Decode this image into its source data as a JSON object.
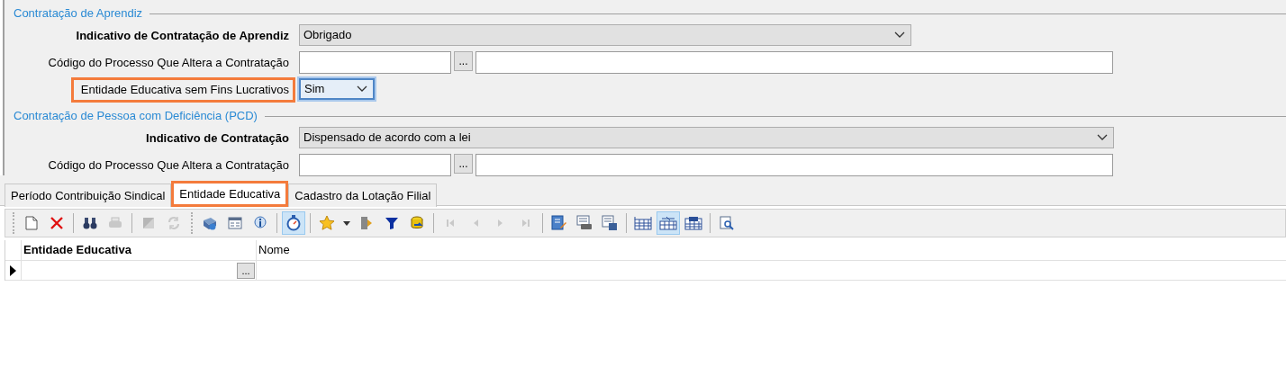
{
  "sections": [
    {
      "legend": "Contratação de Aprendiz",
      "rows": [
        {
          "kind": "select",
          "label": "Indicativo de Contratação de Aprendiz",
          "required": true,
          "highlighted": false,
          "focused": false,
          "value": "Obrigado"
        },
        {
          "kind": "lookup",
          "label": "Código do Processo Que Altera a Contratação",
          "required": false,
          "highlighted": false,
          "button_label": "..."
        },
        {
          "kind": "small_select",
          "label": "Entidade Educativa sem Fins Lucrativos",
          "required": false,
          "highlighted": true,
          "focused": true,
          "value": "Sim"
        }
      ]
    },
    {
      "legend": "Contratação de Pessoa com Deficiência (PCD)",
      "rows": [
        {
          "kind": "long_select",
          "label": "Indicativo de Contratação",
          "required": true,
          "highlighted": false,
          "focused": false,
          "value": "Dispensado de acordo com a lei"
        },
        {
          "kind": "lookup",
          "label": "Código do Processo Que Altera a Contratação",
          "required": false,
          "highlighted": false,
          "button_label": "..."
        }
      ]
    }
  ],
  "tabs": [
    {
      "label": "Período Contribuição Sindical",
      "selected": false,
      "highlighted": false
    },
    {
      "label": "Entidade Educativa",
      "selected": true,
      "highlighted": true
    },
    {
      "label": "Cadastro da Lotação Filial",
      "selected": false,
      "highlighted": false
    }
  ],
  "toolbar": [
    {
      "kind": "grip"
    },
    {
      "kind": "button",
      "disabled": false,
      "selected": false
    },
    {
      "kind": "button",
      "disabled": false,
      "selected": false
    },
    {
      "kind": "separator"
    },
    {
      "kind": "button",
      "disabled": false,
      "selected": false
    },
    {
      "kind": "button",
      "disabled": true,
      "selected": false
    },
    {
      "kind": "separator"
    },
    {
      "kind": "button",
      "disabled": true,
      "selected": false
    },
    {
      "kind": "button",
      "disabled": true,
      "selected": false
    },
    {
      "kind": "grip"
    },
    {
      "kind": "button",
      "disabled": false,
      "selected": false
    },
    {
      "kind": "button",
      "disabled": false,
      "selected": false
    },
    {
      "kind": "button",
      "disabled": false,
      "selected": false
    },
    {
      "kind": "separator"
    },
    {
      "kind": "button",
      "disabled": false,
      "selected": true
    },
    {
      "kind": "separator"
    },
    {
      "kind": "button",
      "disabled": false,
      "selected": false
    },
    {
      "kind": "button",
      "disabled": false,
      "selected": false
    },
    {
      "kind": "button",
      "disabled": false,
      "selected": false
    },
    {
      "kind": "button",
      "disabled": false,
      "selected": false
    },
    {
      "kind": "button",
      "disabled": false,
      "selected": false
    },
    {
      "kind": "separator"
    },
    {
      "kind": "button",
      "disabled": true,
      "selected": false
    },
    {
      "kind": "button",
      "disabled": true,
      "selected": false
    },
    {
      "kind": "button",
      "disabled": true,
      "selected": false
    },
    {
      "kind": "button",
      "disabled": true,
      "selected": false
    },
    {
      "kind": "separator"
    },
    {
      "kind": "button",
      "disabled": false,
      "selected": false
    },
    {
      "kind": "button",
      "disabled": false,
      "selected": false
    },
    {
      "kind": "button",
      "disabled": false,
      "selected": false
    },
    {
      "kind": "separator"
    },
    {
      "kind": "button",
      "disabled": false,
      "selected": false
    },
    {
      "kind": "button",
      "disabled": false,
      "selected": true
    },
    {
      "kind": "button",
      "disabled": false,
      "selected": false
    },
    {
      "kind": "separator"
    },
    {
      "kind": "button",
      "disabled": false,
      "selected": false
    }
  ],
  "grid": {
    "columns": [
      {
        "label": "Entidade Educativa",
        "required": true
      },
      {
        "label": "Nome",
        "required": false
      }
    ],
    "rows": [
      {
        "current": true,
        "cell_button": "..."
      }
    ]
  }
}
